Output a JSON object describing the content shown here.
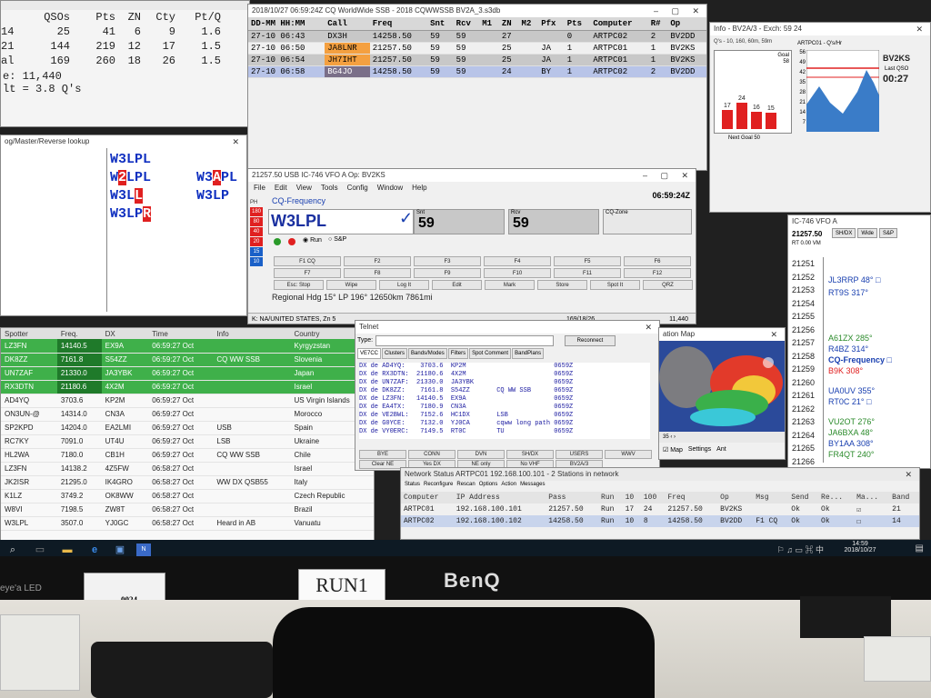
{
  "score": {
    "rows": [
      {
        "c1": "",
        "c2": "QSOs",
        "c3": "Pts",
        "c4": "ZN",
        "c5": "Cty",
        "c6": "Pt/Q"
      },
      {
        "c1": "14",
        "c2": "25",
        "c3": "41",
        "c4": "6",
        "c5": "9",
        "c6": "1.6"
      },
      {
        "c1": "21",
        "c2": "144",
        "c3": "219",
        "c4": "12",
        "c5": "17",
        "c6": "1.5"
      },
      {
        "c1": "al",
        "c2": "169",
        "c3": "260",
        "c4": "18",
        "c5": "26",
        "c6": "1.5"
      }
    ],
    "line1": "e: 11,440",
    "line2": "lt = 3.8 Q's"
  },
  "log": {
    "title": "2018/10/27 06:59:24Z  CQ WorldWide SSB - 2018 CQWWSSB BV2A_3.s3db",
    "headers": [
      "DD-MM HH:MM",
      "Call",
      "Freq",
      "Snt",
      "Rcv",
      "M1",
      "ZN",
      "M2",
      "Pfx",
      "Pts",
      "Computer",
      "R#",
      "Op"
    ],
    "rows": [
      [
        "27-10 06:43",
        "DX3H",
        "14258.50",
        "59",
        "59",
        "",
        "27",
        "",
        "",
        "0",
        "ARTPC02",
        "2",
        "BV2DD"
      ],
      [
        "27-10 06:50",
        "JA8LNR",
        "21257.50",
        "59",
        "59",
        "",
        "25",
        "",
        "JA",
        "1",
        "ARTPC01",
        "1",
        "BV2KS"
      ],
      [
        "27-10 06:54",
        "JH7IHT",
        "21257.50",
        "59",
        "59",
        "",
        "25",
        "",
        "JA",
        "1",
        "ARTPC01",
        "1",
        "BV2KS"
      ],
      [
        "27-10 06:58",
        "BG4JO",
        "14258.50",
        "59",
        "59",
        "",
        "24",
        "",
        "BY",
        "1",
        "ARTPC02",
        "2",
        "BV2DD"
      ]
    ]
  },
  "info": {
    "title": "Info - BV2A/3 - Exch: 59 24",
    "sub": "Q's - 10, 160, 60m, 59m",
    "goal_label": "Goal",
    "goal": "58",
    "next_goal": "Next Goal 50",
    "bars": [
      "17",
      "24",
      "16",
      "15"
    ],
    "station": "ARTPC01 - Q's/Hr",
    "callsign": "BV2KS",
    "last_qso_label": "Last QSO",
    "last_qso": "00:27",
    "y_ticks": [
      "56",
      "49",
      "42",
      "35",
      "28",
      "21",
      "14",
      "7"
    ]
  },
  "check": {
    "title": "og/Master/Reverse lookup",
    "calls": [
      "W3LPL",
      "W2LPL",
      "W3LL",
      "W3LPR",
      "W3APL",
      "W3LP"
    ]
  },
  "entry": {
    "title": "21257.50 USB IC-746 VFO A    Op: BV2KS",
    "menu": [
      "File",
      "Edit",
      "View",
      "Tools",
      "Config",
      "Window",
      "Help"
    ],
    "time": "06:59:24Z",
    "cq_label": "CQ-Frequency",
    "call": "W3LPL",
    "snt_label": "Snt",
    "snt": "59",
    "rcv_label": "Rcv",
    "rcv": "59",
    "cqzone_label": "CQ-Zone",
    "pwr_label": "PH",
    "pwr": [
      "180",
      "80",
      "40",
      "20",
      "15",
      "10"
    ],
    "run_label": "Run",
    "sp_label": "S&P",
    "fkeys": [
      "F1 CQ",
      "F2",
      "F3",
      "F4",
      "F5",
      "F6",
      "F7",
      "F8",
      "F9",
      "F10",
      "F11",
      "F12",
      "Esc: Stop",
      "Wipe",
      "Log It",
      "Edit",
      "Mark",
      "Store",
      "Spot It",
      "QRZ"
    ],
    "hdg": "Regional Hdg  15°   LP 196°   12650km  7861mi",
    "status_left": "K: NA/UNITED STATES, Zn 5",
    "status_mid": "169/18/26",
    "status_right": "11,440"
  },
  "bandmap": {
    "title": "IC-746 VFO A",
    "freq": "21257.50",
    "btns": [
      "SH/DX",
      "Wide",
      "S&P"
    ],
    "rt": "RT   0.00   VM",
    "freqs": [
      "21251",
      "21252",
      "21253",
      "21254",
      "21255",
      "21256",
      "21257",
      "21258",
      "21259",
      "21260",
      "21261",
      "21262",
      "21263",
      "21264",
      "21265",
      "21266"
    ],
    "spots": [
      {
        "t": "JL3RRP 48°",
        "c": "#1a40b0",
        "dot": "□"
      },
      {
        "t": "RT9S 317°",
        "c": "#1a40b0",
        "dot": ""
      },
      {
        "t": "A61ZX 285°",
        "c": "#2a8a2a",
        "dot": ""
      },
      {
        "t": "R4BZ 314°",
        "c": "#1a40b0",
        "dot": ""
      },
      {
        "t": "CQ-Frequency",
        "c": "#1a40b0",
        "dot": "□"
      },
      {
        "t": "B9K 308°",
        "c": "#e02020",
        "dot": ""
      },
      {
        "t": "UA0UV 355°",
        "c": "#1a40b0",
        "dot": ""
      },
      {
        "t": "RT0C 21°",
        "c": "#1a40b0",
        "dot": "□"
      },
      {
        "t": "VU2OT 276°",
        "c": "#2a8a2a",
        "dot": ""
      },
      {
        "t": "JA6BXA 48°",
        "c": "#2a8a2a",
        "dot": ""
      },
      {
        "t": "BY1AA 308°",
        "c": "#1a40b0",
        "dot": ""
      },
      {
        "t": "FR4QT 240°",
        "c": "#2a8a2a",
        "dot": ""
      }
    ]
  },
  "spots": {
    "headers": [
      "Spotter",
      "Freq.",
      "DX",
      "Time",
      "Info",
      "Country"
    ],
    "rows": [
      {
        "c": [
          "LZ3FN",
          "14140.5",
          "EX9A",
          "06:59:27 Oct",
          "",
          "Kyrgyzstan"
        ],
        "g": true
      },
      {
        "c": [
          "DK8ZZ",
          "7161.8",
          "S54ZZ",
          "06:59:27 Oct",
          "CQ WW SSB",
          "Slovenia"
        ],
        "g": true
      },
      {
        "c": [
          "UN7ZAF",
          "21330.0",
          "JA3YBK",
          "06:59:27 Oct",
          "",
          "Japan"
        ],
        "g": true
      },
      {
        "c": [
          "RX3DTN",
          "21180.6",
          "4X2M",
          "06:59:27 Oct",
          "",
          "Israel"
        ],
        "g": true
      },
      {
        "c": [
          "AD4YQ",
          "3703.6",
          "KP2M",
          "06:59:27 Oct",
          "",
          "US Virgin Islands"
        ],
        "g": false
      },
      {
        "c": [
          "ON3UN-@",
          "14314.0",
          "CN3A",
          "06:59:27 Oct",
          "",
          "Morocco"
        ],
        "g": false
      },
      {
        "c": [
          "SP2KPD",
          "14204.0",
          "EA2LMI",
          "06:59:27 Oct",
          "USB",
          "Spain"
        ],
        "g": false
      },
      {
        "c": [
          "RC7KY",
          "7091.0",
          "UT4U",
          "06:59:27 Oct",
          "LSB",
          "Ukraine"
        ],
        "g": false
      },
      {
        "c": [
          "HL2WA",
          "7180.0",
          "CB1H",
          "06:59:27 Oct",
          "CQ WW SSB",
          "Chile"
        ],
        "g": false
      },
      {
        "c": [
          "LZ3FN",
          "14138.2",
          "4Z5FW",
          "06:58:27 Oct",
          "",
          "Israel"
        ],
        "g": false
      },
      {
        "c": [
          "JK2ISR",
          "21295.0",
          "IK4GRO",
          "06:58:27 Oct",
          "WW DX QSB55",
          "Italy"
        ],
        "g": false
      },
      {
        "c": [
          "K1LZ",
          "3749.2",
          "OK8WW",
          "06:58:27 Oct",
          "",
          "Czech Republic"
        ],
        "g": false
      },
      {
        "c": [
          "W8VI",
          "7198.5",
          "ZW8T",
          "06:58:27 Oct",
          "",
          "Brazil"
        ],
        "g": false
      },
      {
        "c": [
          "W3LPL",
          "3507.0",
          "YJ0GC",
          "06:58:27 Oct",
          "Heard in AB",
          "Vanuatu"
        ],
        "g": false
      }
    ]
  },
  "telnet": {
    "title": "Telnet",
    "type_label": "Type:",
    "reconnect": "Reconnect",
    "tabs": [
      "VE7CC",
      "Clusters",
      "Bands/Modes",
      "Filters",
      "Spot Comment",
      "BandPlans"
    ],
    "lines": [
      "DX de AD4YQ:    3703.6  KP2M                       0659Z",
      "DX de RX3DTN:  21180.6  4X2M                       0659Z",
      "DX de UN7ZAF:  21330.0  JA3YBK                     0659Z",
      "DX de DK8ZZ:    7161.8  S54ZZ       CQ WW SSB      0659Z",
      "DX de LZ3FN:   14140.5  EX9A                       0659Z",
      "DX de EA4TX:    7180.9  CN3A                       0659Z",
      "DX de VE2BWL:   7152.6  HC1DX       LSB            0659Z",
      "DX de G0YCE:    7132.0  YJ0CA       cqww long path 0659Z",
      "DX de VY0ERC:   7149.5  RT0C        TU             0659Z"
    ],
    "btns1": [
      "BYE",
      "CONN",
      "DVN",
      "SH/DX",
      "USERS",
      "WWV"
    ],
    "btns2": [
      "Clear NE",
      "Yes DX",
      "NE only",
      "No VHF",
      "BV2A/3"
    ]
  },
  "map": {
    "title": "ation Map",
    "map_label": "Map",
    "settings": "Settings",
    "ant": "Ant"
  },
  "net": {
    "title": "Network Status ARTPC01 192.168.100.101 - 2 Stations in network",
    "tabs": [
      "Status",
      "Reconfigure",
      "Rescan",
      "Options",
      "Action",
      "Messages"
    ],
    "headers": [
      "Computer",
      "IP Address",
      "Pass",
      "Run",
      "10",
      "100",
      "Freq",
      "Op",
      "Msg",
      "Send",
      "Re...",
      "Ma...",
      "Band"
    ],
    "rows": [
      [
        "ARTPC01",
        "192.168.100.101",
        "21257.50",
        "Run",
        "17",
        "24",
        "21257.50",
        "BV2KS",
        "",
        "Ok",
        "Ok",
        "☑",
        "21"
      ],
      [
        "ARTPC02",
        "192.168.100.102",
        "14258.50",
        "Run",
        "10",
        "8",
        "14258.50",
        "BV2DD",
        "F1 CQ",
        "Ok",
        "Ok",
        "☐",
        "14"
      ]
    ]
  },
  "taskbar": {
    "time": "14:59",
    "date": "2018/10/27"
  },
  "photo": {
    "brand": "BenQ",
    "led": "eye'a LED",
    "sticker_main": "RUN1",
    "sticker_tag": "0024"
  }
}
